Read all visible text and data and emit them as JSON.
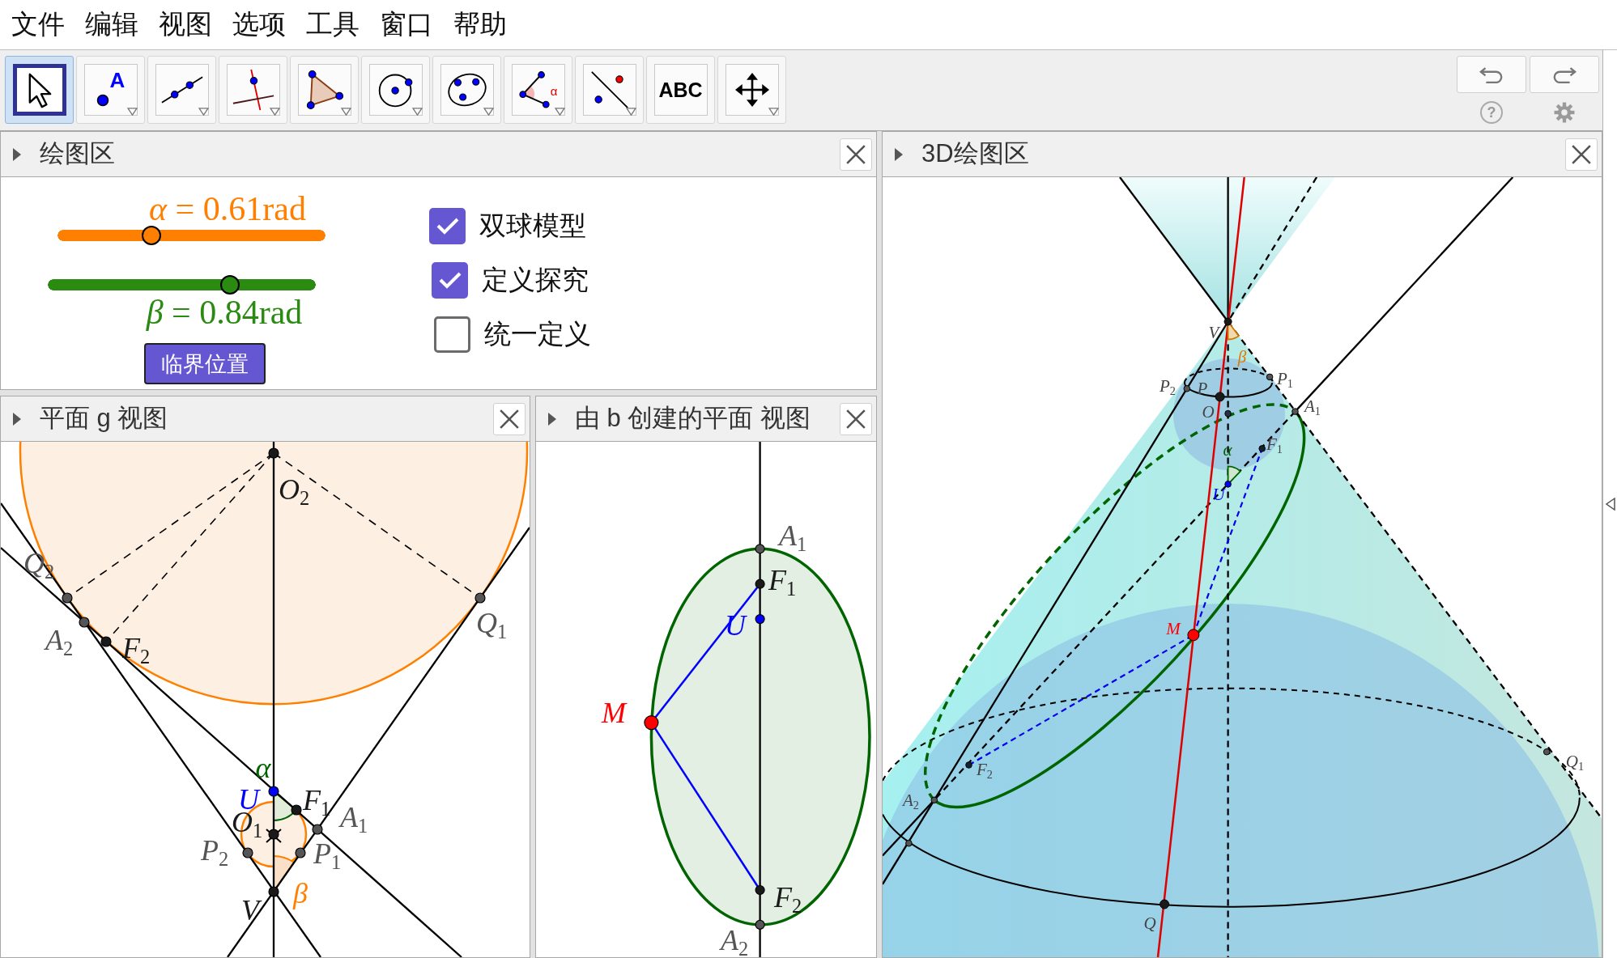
{
  "menu_bar": {
    "items": [
      "文件",
      "编辑",
      "视图",
      "选项",
      "工具",
      "窗口",
      "帮助"
    ]
  },
  "toolbar": {
    "tools": [
      {
        "kind": "move",
        "selected": true,
        "submenu": false
      },
      {
        "kind": "point",
        "text": "A",
        "selected": false,
        "submenu": true
      },
      {
        "kind": "line",
        "selected": false,
        "submenu": true
      },
      {
        "kind": "perpendicular",
        "selected": false,
        "submenu": true
      },
      {
        "kind": "polygon",
        "selected": false,
        "submenu": true
      },
      {
        "kind": "circle",
        "selected": false,
        "submenu": true
      },
      {
        "kind": "conic",
        "selected": false,
        "submenu": true
      },
      {
        "kind": "angle",
        "text": "α",
        "selected": false,
        "submenu": true
      },
      {
        "kind": "reflect",
        "selected": false,
        "submenu": true
      },
      {
        "kind": "text",
        "text": "ABC",
        "selected": false,
        "submenu": false
      },
      {
        "kind": "move_view",
        "selected": false,
        "submenu": true
      }
    ],
    "help": "?"
  },
  "graphics_view": {
    "title": "绘图区",
    "sliders": [
      {
        "label": "*α* = 0.61rad",
        "color": "#ff7f00",
        "level": 0.35,
        "label_above": true
      },
      {
        "label": "*β* = 0.84rad",
        "color": "#2a8a12",
        "level": 0.68,
        "label_above": false
      }
    ],
    "button": "临界位置",
    "checkboxes": [
      {
        "label": "双球模型",
        "checked": true
      },
      {
        "label": "定义探究",
        "checked": true
      },
      {
        "label": "统一定义",
        "checked": false
      }
    ]
  },
  "plane_g_view": {
    "title": "平面 g 视图",
    "labels": [
      {
        "text": "O$_{2}$",
        "color": "#1a1a1a"
      },
      {
        "text": "Q$_{2}$",
        "color": "#555555"
      },
      {
        "text": "A$_{2}$",
        "color": "#555555"
      },
      {
        "text": "F$_{2}$",
        "color": "#1a1a1a"
      },
      {
        "text": "Q$_{1}$",
        "color": "#555555"
      },
      {
        "text": "α",
        "color": "#006400"
      },
      {
        "text": "U",
        "color": "#0000ff"
      },
      {
        "text": "F$_{1}$",
        "color": "#1a1a1a"
      },
      {
        "text": "A$_{1}$",
        "color": "#555555"
      },
      {
        "text": "O$_{1}$",
        "color": "#1a1a1a"
      },
      {
        "text": "P$_{2}$",
        "color": "#555555"
      },
      {
        "text": "P$_{1}$",
        "color": "#555555"
      },
      {
        "text": "β",
        "color": "#ff7f00"
      },
      {
        "text": "V",
        "color": "#1a1a1a"
      }
    ]
  },
  "plane_b_view": {
    "title": "由 b 创建的平面 视图",
    "labels": [
      {
        "text": "A$_{1}$",
        "color": "#555555"
      },
      {
        "text": "F$_{1}$",
        "color": "#1a1a1a"
      },
      {
        "text": "U",
        "color": "#0000ff"
      },
      {
        "text": "M",
        "color": "#ff0000"
      },
      {
        "text": "F$_{2}$",
        "color": "#1a1a1a"
      },
      {
        "text": "A$_{2}$",
        "color": "#555555"
      }
    ]
  },
  "view_3d": {
    "title": "3D绘图区",
    "labels": [
      {
        "text": "V",
        "color": "#444444"
      },
      {
        "text": "β",
        "color": "#e07800"
      },
      {
        "text": "P$_{1}$",
        "color": "#444444"
      },
      {
        "text": "P$_{2}$",
        "color": "#444444"
      },
      {
        "text": "P",
        "color": "#444444"
      },
      {
        "text": "A$_{1}$",
        "color": "#444444"
      },
      {
        "text": "O",
        "color": "#444444"
      },
      {
        "text": "F$_{1}$",
        "color": "#444444"
      },
      {
        "text": "α",
        "color": "#006400"
      },
      {
        "text": "U",
        "color": "#0000ff"
      },
      {
        "text": "M",
        "color": "#ff0000"
      },
      {
        "text": "Q$_{1}$",
        "color": "#444444"
      },
      {
        "text": "F$_{2}$",
        "color": "#444444"
      },
      {
        "text": "A$_{2}$",
        "color": "#444444"
      },
      {
        "text": "Q",
        "color": "#444444"
      }
    ]
  }
}
